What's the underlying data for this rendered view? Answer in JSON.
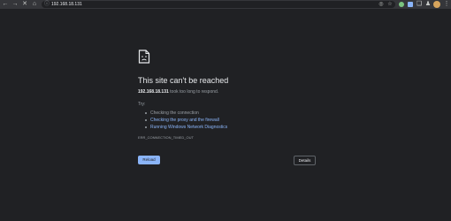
{
  "toolbar": {
    "back_icon": "back-arrow-icon",
    "forward_icon": "forward-arrow-icon",
    "stop_icon": "close-icon",
    "home_icon": "home-icon",
    "url": "192.168.18.131",
    "site_info_icon": "info-icon",
    "extensions": [
      "shield-icon",
      "download-icon",
      "puzzle-icon",
      "profile-icon"
    ],
    "avatar_initial": "",
    "menu_icon": "kebab-menu-icon"
  },
  "error": {
    "title": "This site can't be reached",
    "host": "192.168.18.131",
    "message": "took too long to respond.",
    "try_label": "Try:",
    "suggestions": [
      "Checking the connection",
      "Checking the proxy and the firewall",
      "Running Windows Network Diagnostics"
    ],
    "error_code": "ERR_CONNECTION_TIMED_OUT",
    "reload_label": "Reload",
    "details_label": "Details"
  },
  "colors": {
    "background": "#202124",
    "toolbar": "#35363a",
    "link": "#8ab4f8",
    "secondary_text": "#9aa0a6"
  }
}
